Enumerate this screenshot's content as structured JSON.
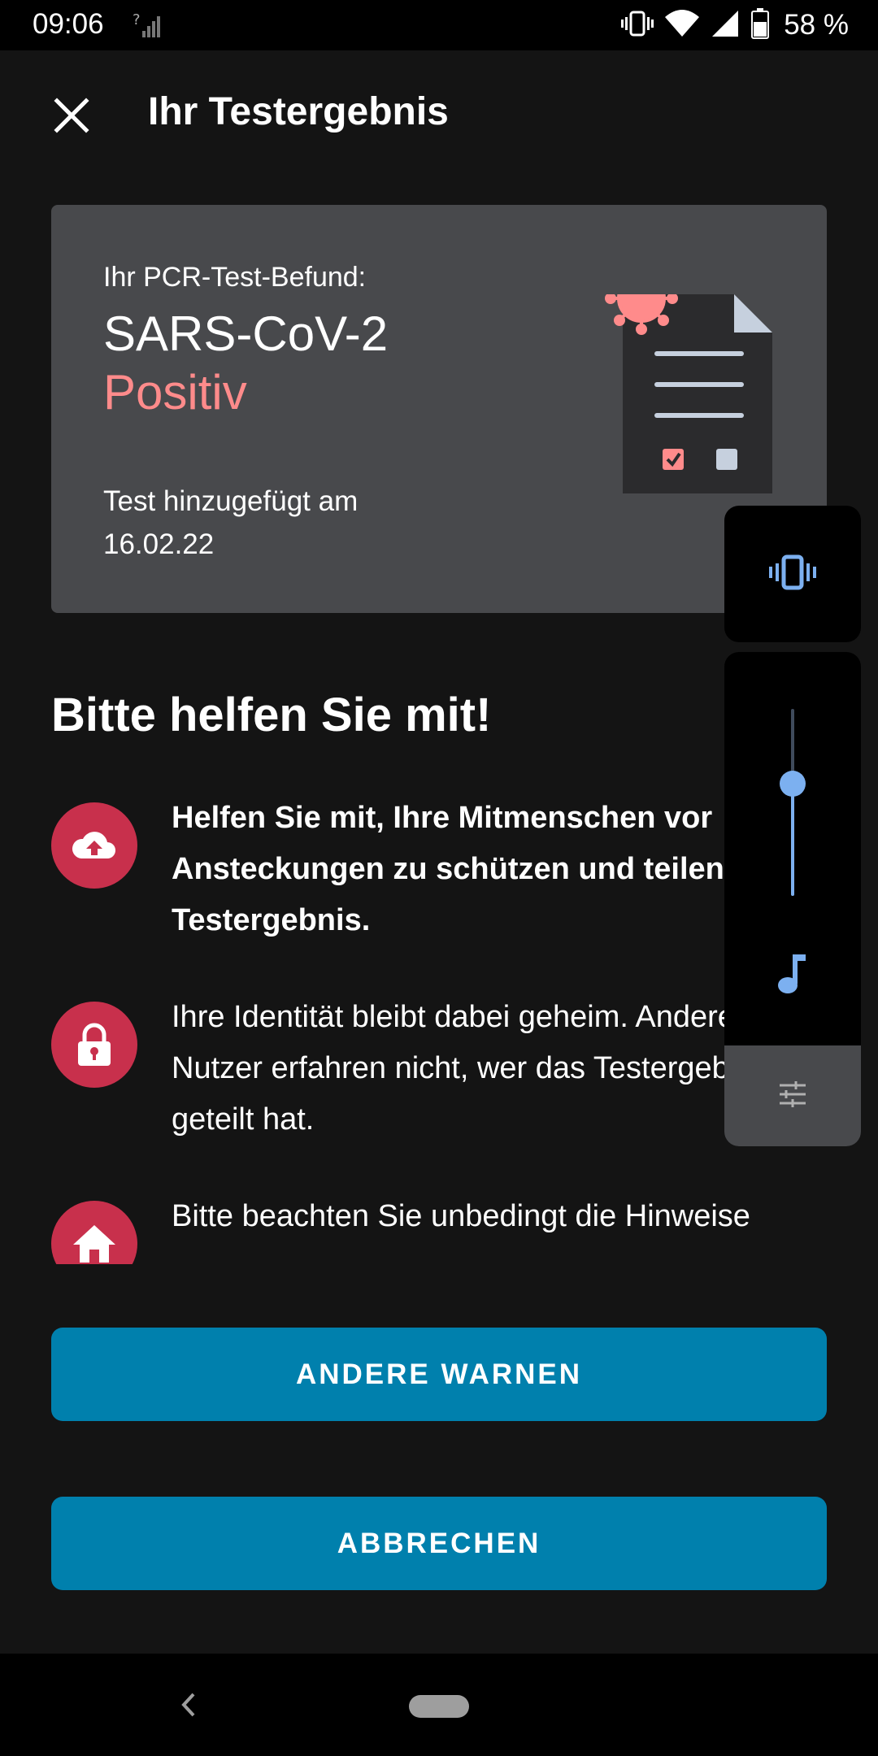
{
  "status_bar": {
    "time": "09:06",
    "battery_text": "58 %",
    "icons": [
      "no-signal-icon",
      "vibrate-icon",
      "wifi-icon",
      "signal-icon",
      "battery-icon"
    ]
  },
  "app_bar": {
    "title": "Ihr Testergebnis",
    "close_icon": "close-icon"
  },
  "result_card": {
    "label": "Ihr PCR-Test-Befund:",
    "virus": "SARS-CoV-2",
    "result": "Positiv",
    "added_label": "Test hinzugefügt am",
    "added_date": "16.02.22",
    "illustration": "document-virus-icon"
  },
  "help": {
    "heading": "Bitte helfen Sie mit!",
    "items": [
      {
        "icon": "cloud-upload-icon",
        "text": "Helfen Sie mit, Ihre Mitmenschen vor Ansteckungen zu schützen und teilen Ihr Testergebnis."
      },
      {
        "icon": "lock-icon",
        "text": "Ihre Identität bleibt dabei geheim. Andere Nutzer erfahren nicht, wer das Testergebnis geteilt hat."
      },
      {
        "icon": "home-icon",
        "text": "Bitte beachten Sie unbedingt die Hinweise"
      }
    ]
  },
  "buttons": {
    "warn": "ANDERE WARNEN",
    "cancel": "ABBRECHEN"
  },
  "volume_overlay": {
    "mode_icon": "vibrate-icon",
    "level": 0.6,
    "stream_icon": "music-note-icon",
    "settings_icon": "tune-icon"
  },
  "colors": {
    "accent": "#0080ad",
    "positive": "#ff8b8b",
    "icon_circle": "#c8304c",
    "card": "#48494c",
    "volume_accent": "#7cb0f0"
  }
}
